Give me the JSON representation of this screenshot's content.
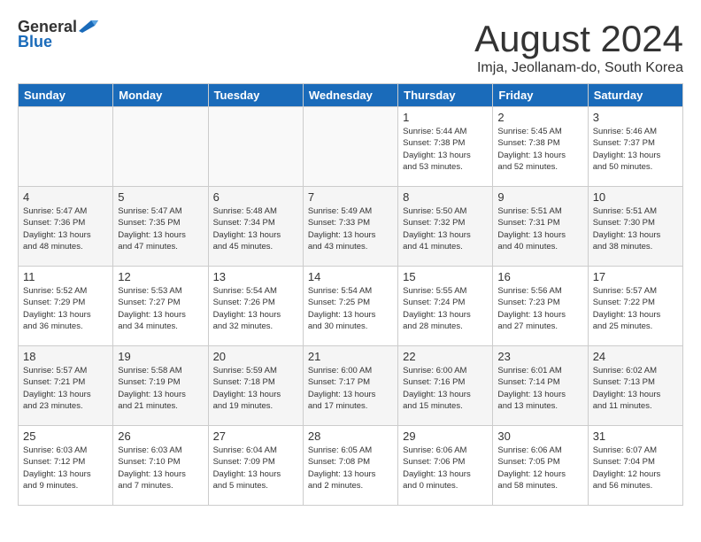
{
  "header": {
    "logo_general": "General",
    "logo_blue": "Blue",
    "month_year": "August 2024",
    "location": "Imja, Jeollanam-do, South Korea"
  },
  "weekdays": [
    "Sunday",
    "Monday",
    "Tuesday",
    "Wednesday",
    "Thursday",
    "Friday",
    "Saturday"
  ],
  "weeks": [
    [
      {
        "day": "",
        "info": ""
      },
      {
        "day": "",
        "info": ""
      },
      {
        "day": "",
        "info": ""
      },
      {
        "day": "",
        "info": ""
      },
      {
        "day": "1",
        "info": "Sunrise: 5:44 AM\nSunset: 7:38 PM\nDaylight: 13 hours\nand 53 minutes."
      },
      {
        "day": "2",
        "info": "Sunrise: 5:45 AM\nSunset: 7:38 PM\nDaylight: 13 hours\nand 52 minutes."
      },
      {
        "day": "3",
        "info": "Sunrise: 5:46 AM\nSunset: 7:37 PM\nDaylight: 13 hours\nand 50 minutes."
      }
    ],
    [
      {
        "day": "4",
        "info": "Sunrise: 5:47 AM\nSunset: 7:36 PM\nDaylight: 13 hours\nand 48 minutes."
      },
      {
        "day": "5",
        "info": "Sunrise: 5:47 AM\nSunset: 7:35 PM\nDaylight: 13 hours\nand 47 minutes."
      },
      {
        "day": "6",
        "info": "Sunrise: 5:48 AM\nSunset: 7:34 PM\nDaylight: 13 hours\nand 45 minutes."
      },
      {
        "day": "7",
        "info": "Sunrise: 5:49 AM\nSunset: 7:33 PM\nDaylight: 13 hours\nand 43 minutes."
      },
      {
        "day": "8",
        "info": "Sunrise: 5:50 AM\nSunset: 7:32 PM\nDaylight: 13 hours\nand 41 minutes."
      },
      {
        "day": "9",
        "info": "Sunrise: 5:51 AM\nSunset: 7:31 PM\nDaylight: 13 hours\nand 40 minutes."
      },
      {
        "day": "10",
        "info": "Sunrise: 5:51 AM\nSunset: 7:30 PM\nDaylight: 13 hours\nand 38 minutes."
      }
    ],
    [
      {
        "day": "11",
        "info": "Sunrise: 5:52 AM\nSunset: 7:29 PM\nDaylight: 13 hours\nand 36 minutes."
      },
      {
        "day": "12",
        "info": "Sunrise: 5:53 AM\nSunset: 7:27 PM\nDaylight: 13 hours\nand 34 minutes."
      },
      {
        "day": "13",
        "info": "Sunrise: 5:54 AM\nSunset: 7:26 PM\nDaylight: 13 hours\nand 32 minutes."
      },
      {
        "day": "14",
        "info": "Sunrise: 5:54 AM\nSunset: 7:25 PM\nDaylight: 13 hours\nand 30 minutes."
      },
      {
        "day": "15",
        "info": "Sunrise: 5:55 AM\nSunset: 7:24 PM\nDaylight: 13 hours\nand 28 minutes."
      },
      {
        "day": "16",
        "info": "Sunrise: 5:56 AM\nSunset: 7:23 PM\nDaylight: 13 hours\nand 27 minutes."
      },
      {
        "day": "17",
        "info": "Sunrise: 5:57 AM\nSunset: 7:22 PM\nDaylight: 13 hours\nand 25 minutes."
      }
    ],
    [
      {
        "day": "18",
        "info": "Sunrise: 5:57 AM\nSunset: 7:21 PM\nDaylight: 13 hours\nand 23 minutes."
      },
      {
        "day": "19",
        "info": "Sunrise: 5:58 AM\nSunset: 7:19 PM\nDaylight: 13 hours\nand 21 minutes."
      },
      {
        "day": "20",
        "info": "Sunrise: 5:59 AM\nSunset: 7:18 PM\nDaylight: 13 hours\nand 19 minutes."
      },
      {
        "day": "21",
        "info": "Sunrise: 6:00 AM\nSunset: 7:17 PM\nDaylight: 13 hours\nand 17 minutes."
      },
      {
        "day": "22",
        "info": "Sunrise: 6:00 AM\nSunset: 7:16 PM\nDaylight: 13 hours\nand 15 minutes."
      },
      {
        "day": "23",
        "info": "Sunrise: 6:01 AM\nSunset: 7:14 PM\nDaylight: 13 hours\nand 13 minutes."
      },
      {
        "day": "24",
        "info": "Sunrise: 6:02 AM\nSunset: 7:13 PM\nDaylight: 13 hours\nand 11 minutes."
      }
    ],
    [
      {
        "day": "25",
        "info": "Sunrise: 6:03 AM\nSunset: 7:12 PM\nDaylight: 13 hours\nand 9 minutes."
      },
      {
        "day": "26",
        "info": "Sunrise: 6:03 AM\nSunset: 7:10 PM\nDaylight: 13 hours\nand 7 minutes."
      },
      {
        "day": "27",
        "info": "Sunrise: 6:04 AM\nSunset: 7:09 PM\nDaylight: 13 hours\nand 5 minutes."
      },
      {
        "day": "28",
        "info": "Sunrise: 6:05 AM\nSunset: 7:08 PM\nDaylight: 13 hours\nand 2 minutes."
      },
      {
        "day": "29",
        "info": "Sunrise: 6:06 AM\nSunset: 7:06 PM\nDaylight: 13 hours\nand 0 minutes."
      },
      {
        "day": "30",
        "info": "Sunrise: 6:06 AM\nSunset: 7:05 PM\nDaylight: 12 hours\nand 58 minutes."
      },
      {
        "day": "31",
        "info": "Sunrise: 6:07 AM\nSunset: 7:04 PM\nDaylight: 12 hours\nand 56 minutes."
      }
    ]
  ]
}
